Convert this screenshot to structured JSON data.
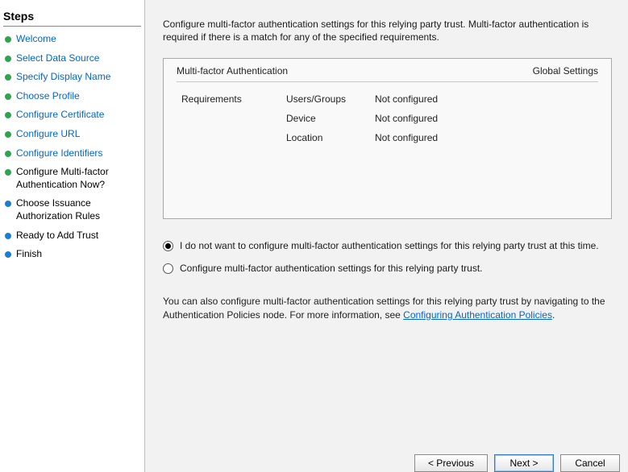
{
  "sidebar": {
    "title": "Steps",
    "steps": [
      {
        "label": "Welcome",
        "state": "done"
      },
      {
        "label": "Select Data Source",
        "state": "done"
      },
      {
        "label": "Specify Display Name",
        "state": "done"
      },
      {
        "label": "Choose Profile",
        "state": "done"
      },
      {
        "label": "Configure Certificate",
        "state": "done"
      },
      {
        "label": "Configure URL",
        "state": "done"
      },
      {
        "label": "Configure Identifiers",
        "state": "done"
      },
      {
        "label": "Configure Multi-factor Authentication Now?",
        "state": "current"
      },
      {
        "label": "Choose Issuance Authorization Rules",
        "state": "pending"
      },
      {
        "label": "Ready to Add Trust",
        "state": "pending"
      },
      {
        "label": "Finish",
        "state": "pending"
      }
    ]
  },
  "content": {
    "intro": "Configure multi-factor authentication settings for this relying party trust. Multi-factor authentication is required if there is a match for any of the specified requirements.",
    "mfa_box": {
      "title_left": "Multi-factor Authentication",
      "title_right": "Global Settings",
      "col1": "Requirements",
      "rows": [
        {
          "label": "Users/Groups",
          "value": "Not configured"
        },
        {
          "label": "Device",
          "value": "Not configured"
        },
        {
          "label": "Location",
          "value": "Not configured"
        }
      ]
    },
    "radios": {
      "opt1": "I do not want to configure multi-factor authentication settings for this relying party trust at this time.",
      "opt2": "Configure multi-factor authentication settings for this relying party trust.",
      "selected": "opt1"
    },
    "footnote_prefix": "You can also configure multi-factor authentication settings for this relying party trust by navigating to the Authentication Policies node. For more information, see ",
    "footnote_link": "Configuring Authentication Policies",
    "footnote_suffix": "."
  },
  "buttons": {
    "previous": "< Previous",
    "next": "Next >",
    "cancel": "Cancel"
  }
}
